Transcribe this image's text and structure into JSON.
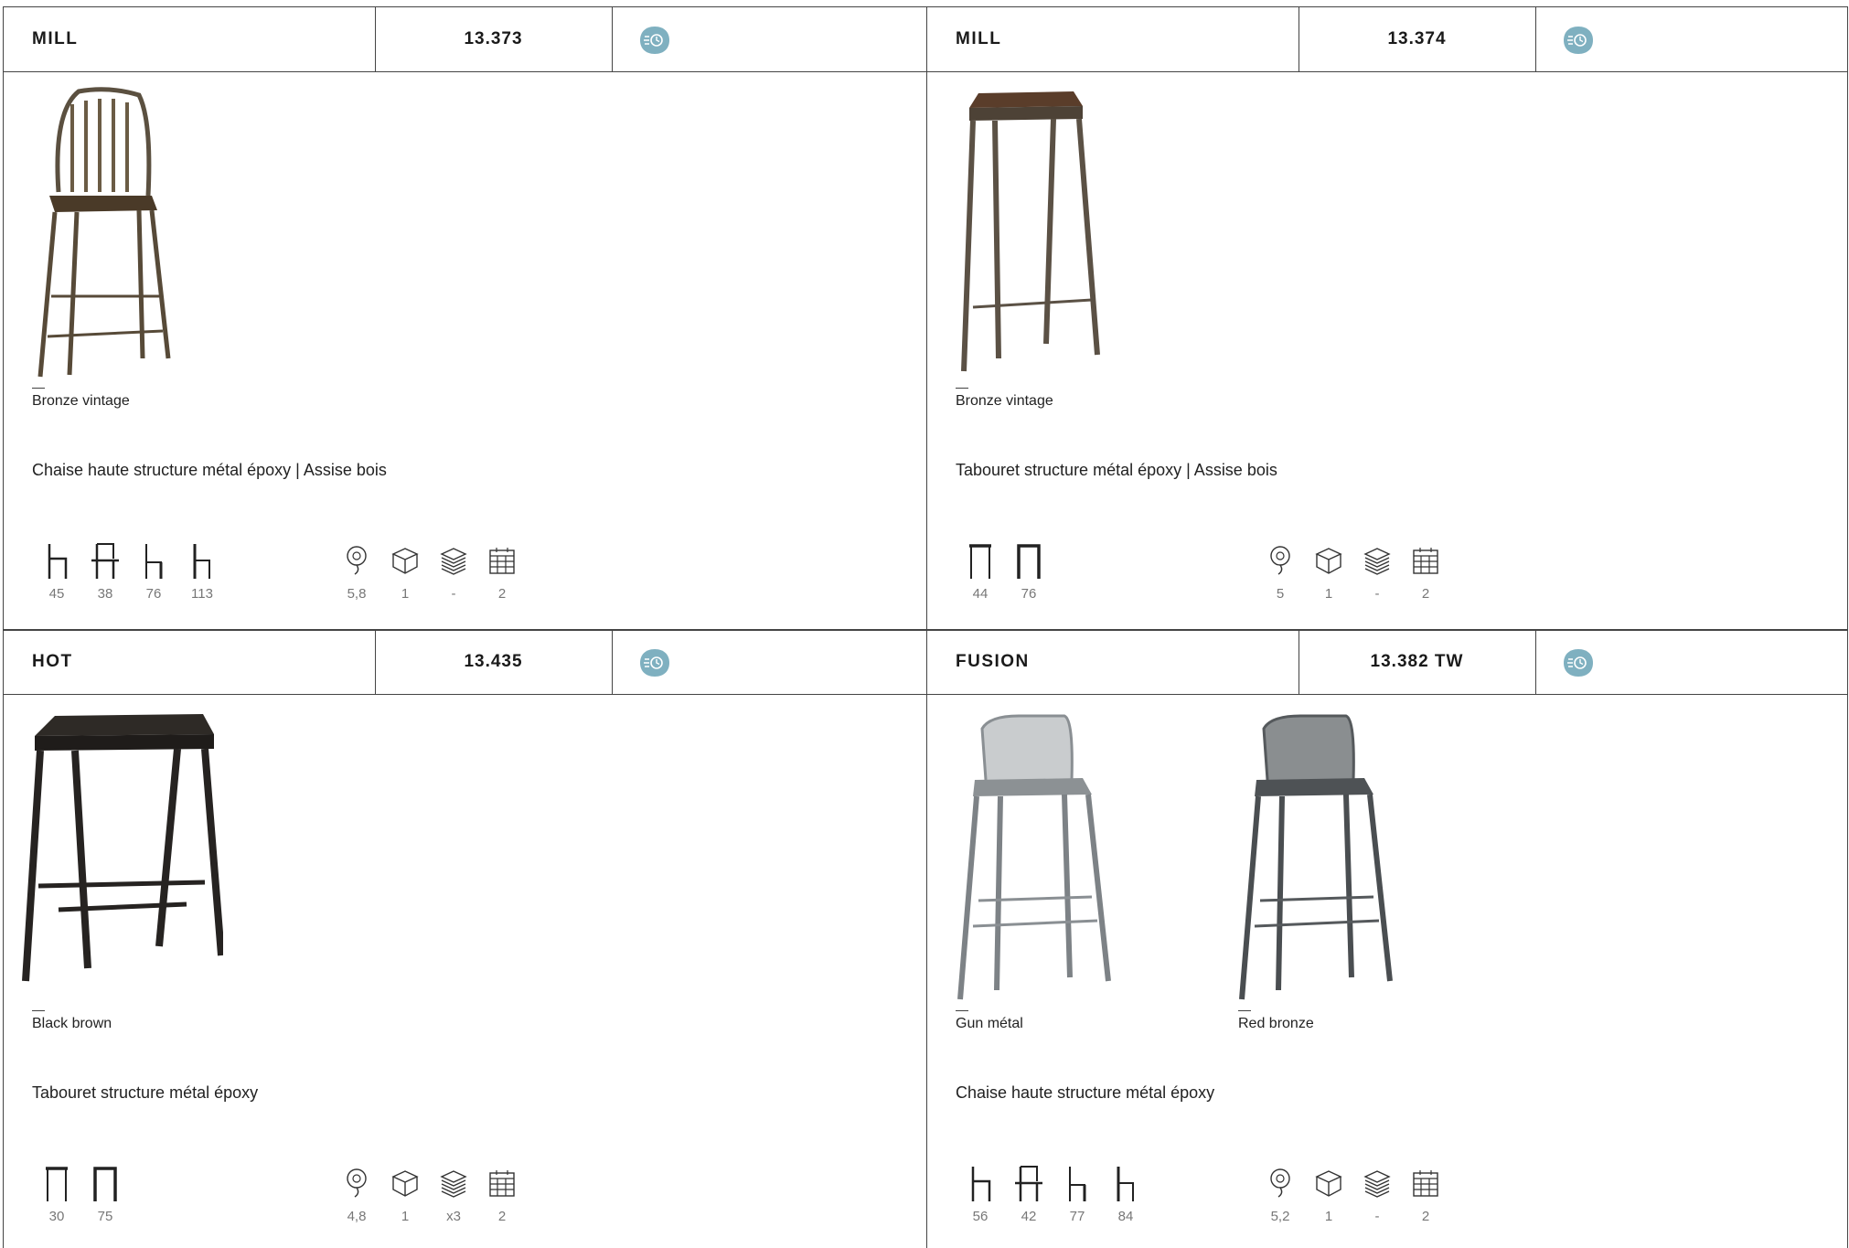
{
  "cards": [
    {
      "name": "MILL",
      "ref": "13.373",
      "variants": [
        "Bronze vintage"
      ],
      "description": "Chaise haute structure métal époxy |  Assise bois",
      "dimensions": [
        {
          "icon": "seat-height-icon",
          "value": "45"
        },
        {
          "icon": "chair-width-icon",
          "value": "38"
        },
        {
          "icon": "chair-depth-icon",
          "value": "76"
        },
        {
          "icon": "total-height-icon",
          "value": "113"
        }
      ],
      "specs": [
        {
          "icon": "weight-icon",
          "value": "5,8"
        },
        {
          "icon": "box-icon",
          "value": "1"
        },
        {
          "icon": "stackable-icon",
          "value": "-"
        },
        {
          "icon": "calendar-icon",
          "value": "2"
        }
      ]
    },
    {
      "name": "MILL",
      "ref": "13.374",
      "variants": [
        "Bronze vintage"
      ],
      "description": "Tabouret structure métal époxy | Assise bois",
      "dimensions": [
        {
          "icon": "stool-width-icon",
          "value": "44"
        },
        {
          "icon": "stool-height-icon",
          "value": "76"
        }
      ],
      "specs": [
        {
          "icon": "weight-icon",
          "value": "5"
        },
        {
          "icon": "box-icon",
          "value": "1"
        },
        {
          "icon": "stackable-icon",
          "value": "-"
        },
        {
          "icon": "calendar-icon",
          "value": "2"
        }
      ]
    },
    {
      "name": "HOT",
      "ref": "13.435",
      "variants": [
        "Black brown"
      ],
      "description": "Tabouret structure métal époxy",
      "dimensions": [
        {
          "icon": "stool-width-icon",
          "value": "30"
        },
        {
          "icon": "stool-height-icon",
          "value": "75"
        }
      ],
      "specs": [
        {
          "icon": "weight-icon",
          "value": "4,8"
        },
        {
          "icon": "box-icon",
          "value": "1"
        },
        {
          "icon": "stackable-icon",
          "value": "x3"
        },
        {
          "icon": "calendar-icon",
          "value": "2"
        }
      ]
    },
    {
      "name": "FUSION",
      "ref": "13.382 TW",
      "variants": [
        "Gun métal",
        "Red bronze"
      ],
      "description": "Chaise haute structure métal époxy",
      "dimensions": [
        {
          "icon": "seat-height-icon",
          "value": "56"
        },
        {
          "icon": "chair-width-icon",
          "value": "42"
        },
        {
          "icon": "chair-depth-icon",
          "value": "77"
        },
        {
          "icon": "total-height-icon",
          "value": "84"
        }
      ],
      "specs": [
        {
          "icon": "weight-icon",
          "value": "5,2"
        },
        {
          "icon": "box-icon",
          "value": "1"
        },
        {
          "icon": "stackable-icon",
          "value": "-"
        },
        {
          "icon": "calendar-icon",
          "value": "2"
        }
      ]
    }
  ],
  "colors": {
    "badge": "#7fb0c0",
    "border": "#444444",
    "muted_text": "#777777"
  }
}
